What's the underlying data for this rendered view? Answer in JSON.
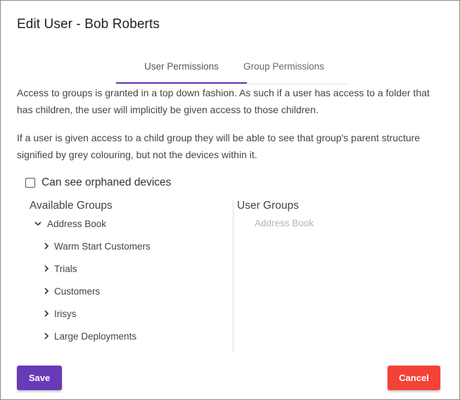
{
  "dialog": {
    "title": "Edit User - Bob Roberts"
  },
  "tabs": [
    {
      "label": "User Permissions",
      "active": true
    },
    {
      "label": "Group Permissions",
      "active": false
    }
  ],
  "description": {
    "para1": "Access to groups is granted in a top down fashion. As such if a user has access to a folder that has children, the user will implicitly be given access to those children.",
    "para2": "If a user is given access to a child group they will be able to see that group's parent structure signified by grey colouring, but not the devices within it."
  },
  "orphaned": {
    "label": "Can see orphaned devices",
    "checked": false
  },
  "available_groups": {
    "heading": "Available Groups",
    "root": {
      "label": "Address Book",
      "icon": "chevron-down-icon"
    },
    "children": [
      {
        "label": "Warm Start Customers",
        "icon": "chevron-right-icon"
      },
      {
        "label": "Trials",
        "icon": "chevron-right-icon"
      },
      {
        "label": "Customers",
        "icon": "chevron-right-icon"
      },
      {
        "label": "Irisys",
        "icon": "chevron-right-icon"
      },
      {
        "label": "Large Deployments",
        "icon": "chevron-right-icon"
      }
    ]
  },
  "user_groups": {
    "heading": "User Groups",
    "root_label": "Address Book"
  },
  "buttons": {
    "save": "Save",
    "cancel": "Cancel"
  },
  "colors": {
    "accent": "#673ab7",
    "danger": "#f44336",
    "muted": "#b5b5b5"
  }
}
